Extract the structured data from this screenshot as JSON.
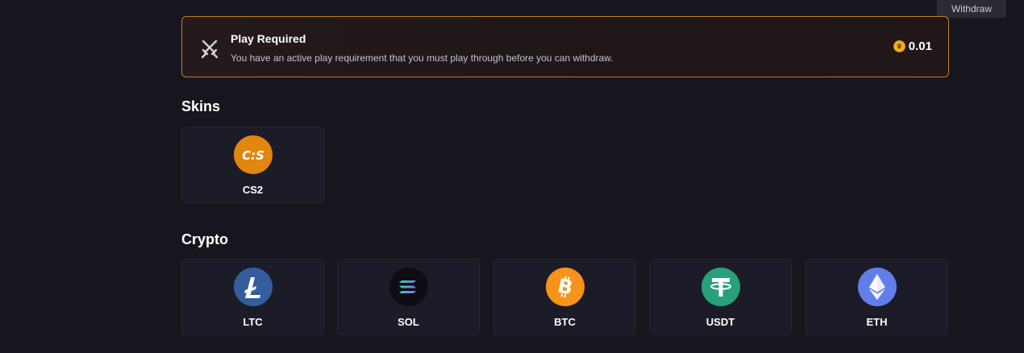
{
  "header": {
    "withdraw_tab": "Withdraw"
  },
  "alert": {
    "icon": "crossed-swords-icon",
    "title": "Play Required",
    "text": "You have an active play requirement that you must play through before you can withdraw.",
    "amount": "0.01",
    "amount_icon": "coin-icon"
  },
  "skins": {
    "title": "Skins",
    "items": [
      {
        "label": "CS2",
        "icon": "cs2-logo-icon",
        "color": "#e2860f"
      }
    ]
  },
  "crypto": {
    "title": "Crypto",
    "items": [
      {
        "label": "LTC",
        "icon": "litecoin-icon",
        "color": "#345d9d"
      },
      {
        "label": "SOL",
        "icon": "solana-icon",
        "color": "#0d0d12"
      },
      {
        "label": "BTC",
        "icon": "bitcoin-icon",
        "color": "#f7931a"
      },
      {
        "label": "USDT",
        "icon": "tether-icon",
        "color": "#26a17b"
      },
      {
        "label": "ETH",
        "icon": "ethereum-icon",
        "color": "#627eea"
      }
    ]
  },
  "colors": {
    "background": "#17161f",
    "card": "#1b1c27",
    "alert_border": "#c07a2c"
  }
}
